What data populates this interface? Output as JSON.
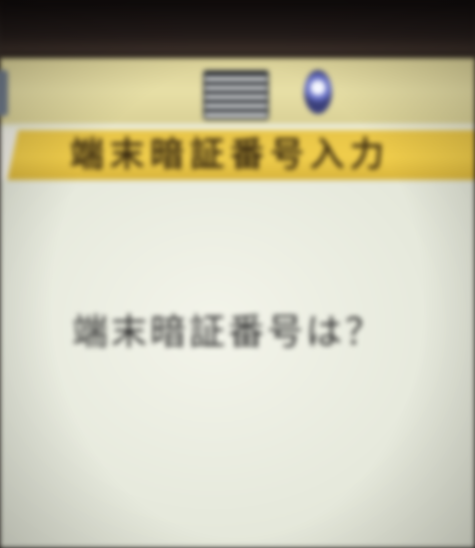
{
  "status_bar": {
    "left_icon": "battery-icon",
    "center_icon": "signal-strength-icon",
    "right_icon": "globe-icon"
  },
  "header": {
    "title": "端末暗証番号入力"
  },
  "main": {
    "prompt": "端末暗証番号は？"
  },
  "colors": {
    "title_bar": "#f0cd4b",
    "status_bar": "#e7dfa6",
    "screen_background": "#eceedf",
    "text": "#2a2a2a"
  }
}
